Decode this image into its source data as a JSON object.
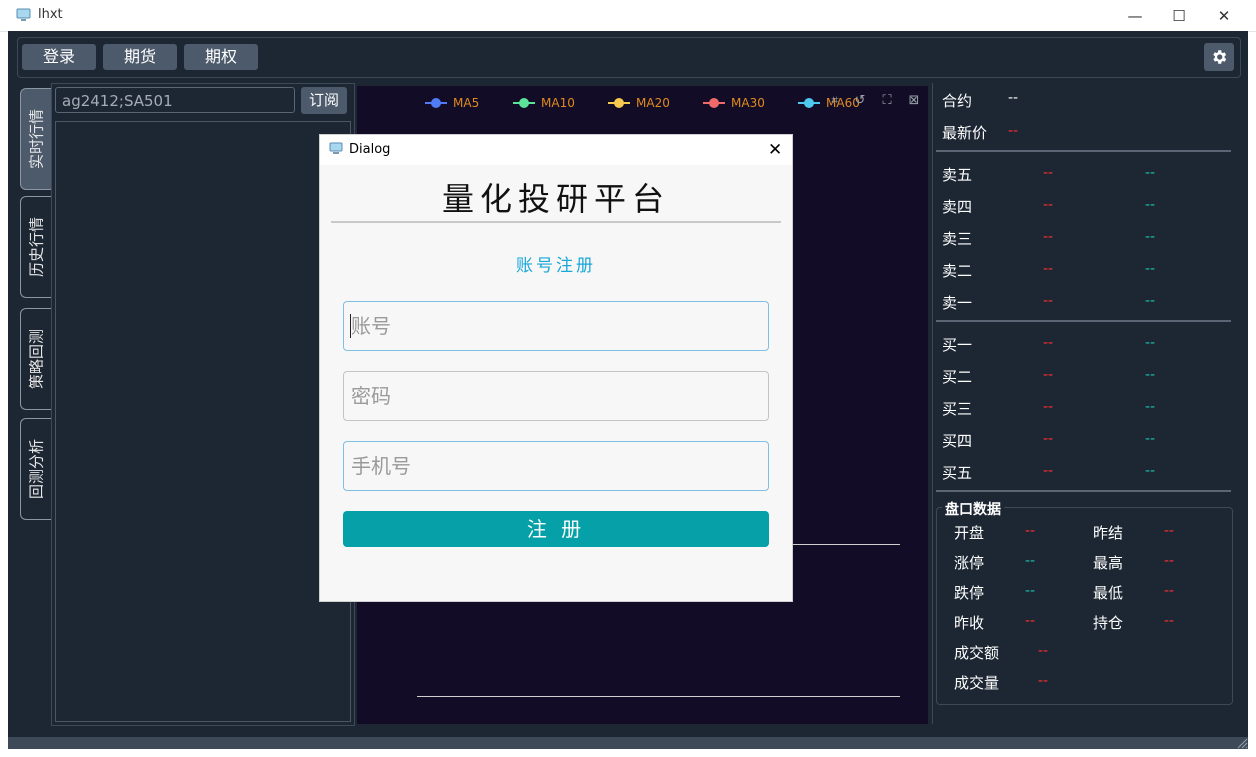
{
  "window": {
    "title": "lhxt",
    "minimize": "—",
    "maximize": "☐",
    "close": "✕"
  },
  "toolbar": {
    "login": "登录",
    "futures": "期货",
    "options": "期权"
  },
  "vtabs": [
    "实时行情",
    "历史行情",
    "策略回测",
    "回测分析"
  ],
  "left": {
    "subscribe_value": "ag2412;SA501",
    "subscribe_btn": "订阅"
  },
  "legend": [
    {
      "name": "MA5",
      "color": "#4f7cf6"
    },
    {
      "name": "MA10",
      "color": "#5ce39a"
    },
    {
      "name": "MA20",
      "color": "#f6c94f"
    },
    {
      "name": "MA30",
      "color": "#f06a6a"
    },
    {
      "name": "MA60",
      "color": "#4fc8f0"
    }
  ],
  "quote": {
    "contract_label": "合约",
    "contract_value": "--",
    "last_label": "最新价",
    "last_value": "--",
    "asks": [
      {
        "label": "卖五",
        "price": "--",
        "vol": "--"
      },
      {
        "label": "卖四",
        "price": "--",
        "vol": "--"
      },
      {
        "label": "卖三",
        "price": "--",
        "vol": "--"
      },
      {
        "label": "卖二",
        "price": "--",
        "vol": "--"
      },
      {
        "label": "卖一",
        "price": "--",
        "vol": "--"
      }
    ],
    "bids": [
      {
        "label": "买一",
        "price": "--",
        "vol": "--"
      },
      {
        "label": "买二",
        "price": "--",
        "vol": "--"
      },
      {
        "label": "买三",
        "price": "--",
        "vol": "--"
      },
      {
        "label": "买四",
        "price": "--",
        "vol": "--"
      },
      {
        "label": "买五",
        "price": "--",
        "vol": "--"
      }
    ]
  },
  "panel": {
    "title": "盘口数据",
    "open_label": "开盘",
    "open_value": "--",
    "presettle_label": "昨结",
    "presettle_value": "--",
    "limitup_label": "涨停",
    "limitup_value": "--",
    "high_label": "最高",
    "high_value": "--",
    "limitdown_label": "跌停",
    "limitdown_value": "--",
    "low_label": "最低",
    "low_value": "--",
    "preclose_label": "昨收",
    "preclose_value": "--",
    "oi_label": "持仓",
    "oi_value": "--",
    "turnover_label": "成交额",
    "turnover_value": "--",
    "volume_label": "成交量",
    "volume_value": "--"
  },
  "dialog": {
    "title": "Dialog",
    "close": "✕",
    "heading": "量化投研平台",
    "subheading": "账号注册",
    "account_placeholder": "账号",
    "password_placeholder": "密码",
    "phone_placeholder": "手机号",
    "register_btn": "注 册"
  }
}
